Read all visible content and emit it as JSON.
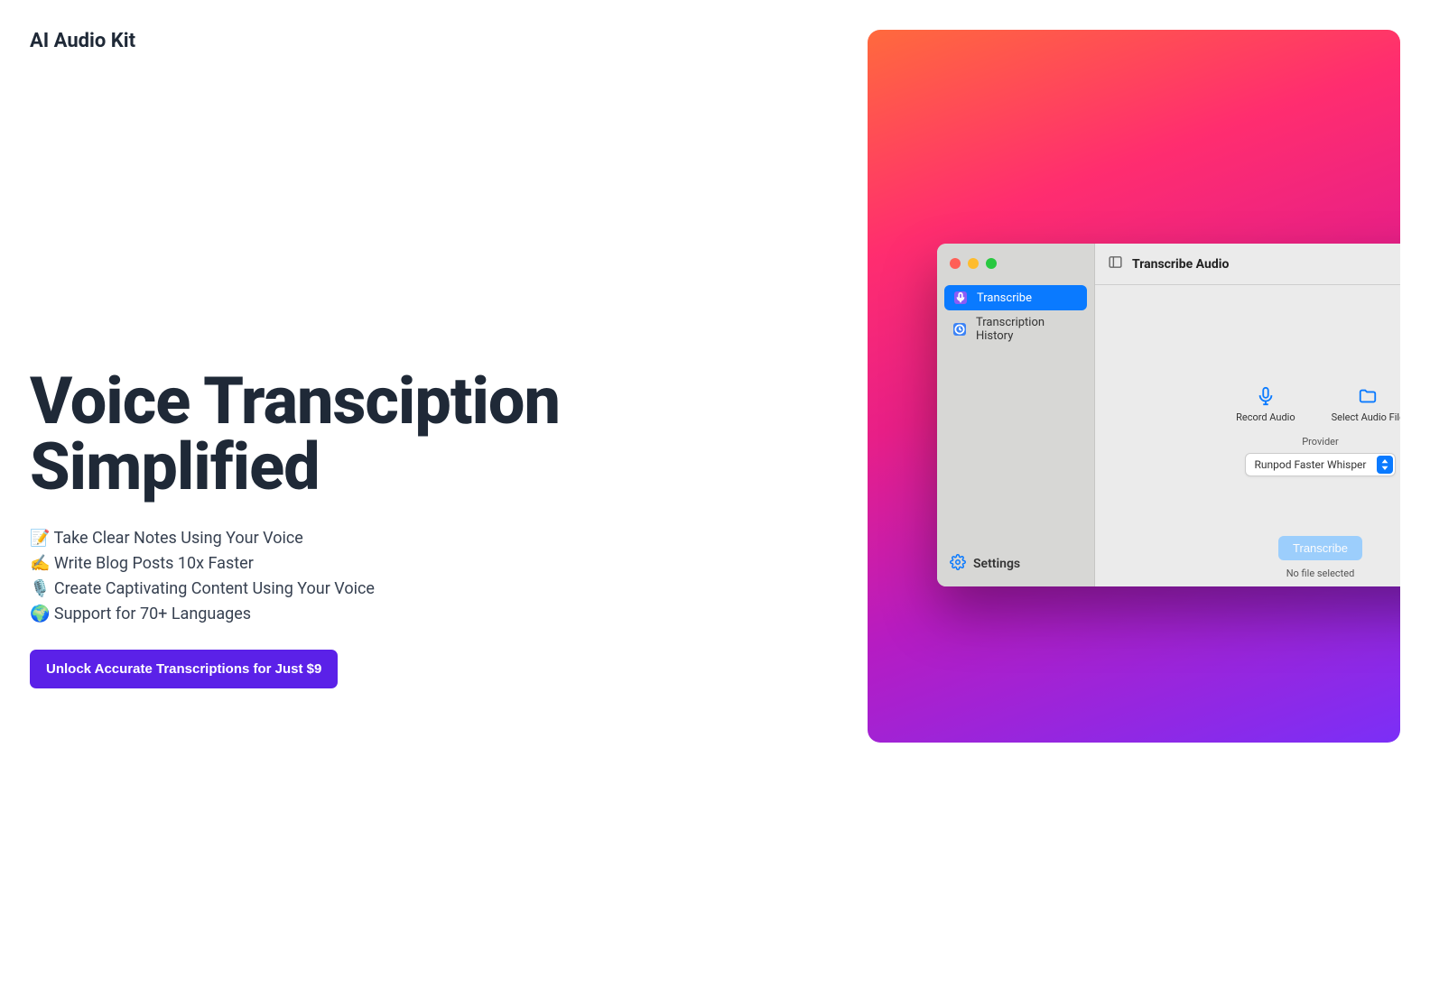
{
  "brand": "AI Audio Kit",
  "hero": {
    "title_line1": "Voice Transciption",
    "title_line2": "Simplified"
  },
  "features": [
    "📝 Take Clear Notes Using Your Voice",
    "✍️ Write Blog Posts 10x Faster",
    "🎙️ Create Captivating Content Using Your Voice",
    "🌍 Support for 70+ Languages"
  ],
  "cta": "Unlock Accurate Transcriptions for Just $9",
  "app": {
    "window_title": "Transcribe Audio",
    "sidebar": {
      "items": [
        {
          "label": "Transcribe",
          "active": true
        },
        {
          "label": "Transcription History",
          "active": false
        }
      ],
      "settings": "Settings"
    },
    "content": {
      "record_label": "Record Audio",
      "select_label": "Select Audio File",
      "provider_label": "Provider",
      "provider_value": "Runpod Faster Whisper",
      "transcribe_button": "Transcribe",
      "status": "No file selected"
    }
  }
}
